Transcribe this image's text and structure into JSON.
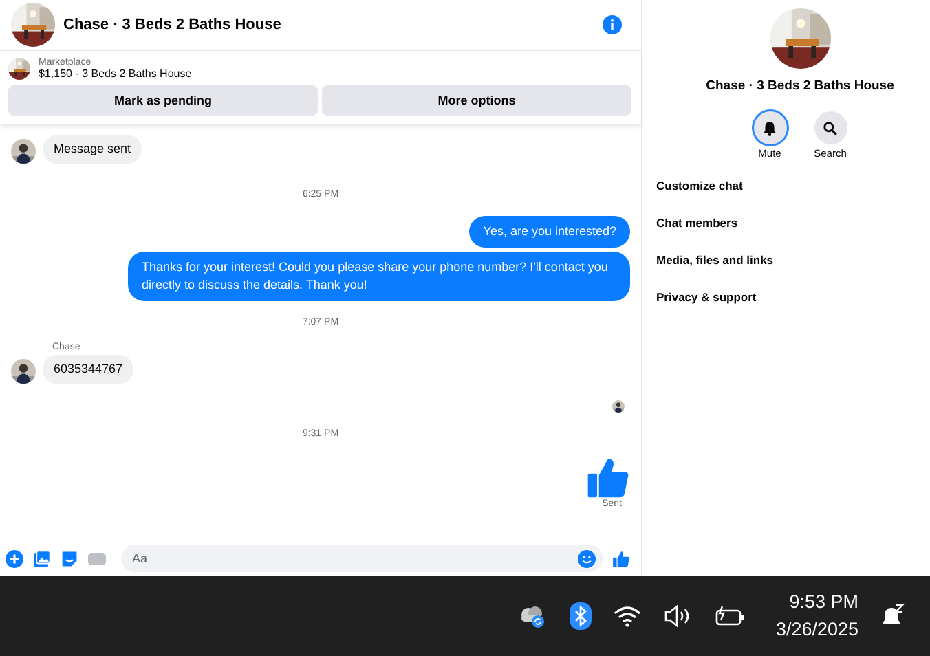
{
  "header": {
    "title": "Chase · 3 Beds 2 Baths House"
  },
  "listing": {
    "source": "Marketplace",
    "summary": "$1,150 - 3 Beds 2 Baths House",
    "actions": [
      "Mark as pending",
      "More options"
    ]
  },
  "messages": [
    {
      "kind": "incoming",
      "text": "Message sent"
    },
    {
      "kind": "time",
      "text": "6:25 PM"
    },
    {
      "kind": "outgoing",
      "text": "Yes, are you interested?"
    },
    {
      "kind": "outgoing",
      "text": "Thanks for your interest! Could you please share your phone number? I'll contact you directly to discuss the details. Thank you!"
    },
    {
      "kind": "time",
      "text": "7:07 PM"
    },
    {
      "kind": "sender",
      "text": "Chase"
    },
    {
      "kind": "incoming",
      "text": "6035344767"
    },
    {
      "kind": "seen"
    },
    {
      "kind": "time",
      "text": "9:31 PM"
    },
    {
      "kind": "like"
    },
    {
      "kind": "status",
      "text": "Sent"
    }
  ],
  "composer": {
    "placeholder": "Aa"
  },
  "details": {
    "title": "Chase · 3 Beds 2 Baths House",
    "actions": [
      {
        "label": "Mute",
        "kind": "bell",
        "selected": true
      },
      {
        "label": "Search",
        "kind": "search",
        "selected": false
      }
    ],
    "menu": [
      "Customize chat",
      "Chat members",
      "Media, files and links",
      "Privacy & support"
    ]
  },
  "taskbar": {
    "time": "9:53 PM",
    "date": "3/26/2025"
  }
}
